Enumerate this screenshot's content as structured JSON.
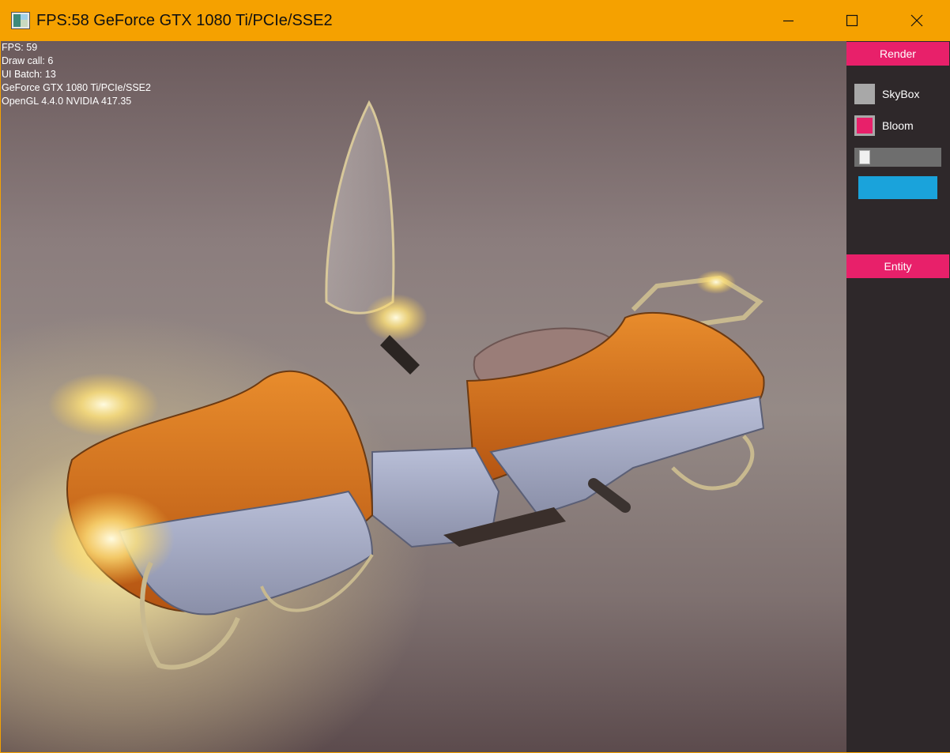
{
  "window": {
    "title": "FPS:58 GeForce GTX 1080 Ti/PCIe/SSE2",
    "accent_color": "#f5a100"
  },
  "stats": {
    "lines": [
      "FPS: 59",
      "Draw call: 6",
      "UI Batch: 13",
      "GeForce GTX 1080 Ti/PCIe/SSE2",
      "OpenGL 4.4.0 NVIDIA 417.35"
    ]
  },
  "panel": {
    "render_header": "Render",
    "entity_header": "Entity",
    "skybox": {
      "label": "SkyBox",
      "checked": false
    },
    "bloom": {
      "label": "Bloom",
      "checked": true
    },
    "slider": {
      "value": 0.03
    },
    "color_swatch": "#1aa3db",
    "header_color": "#e8206a"
  },
  "icons": {
    "app": "app-window-icon",
    "minimize": "minimize-icon",
    "maximize": "maximize-icon",
    "close": "close-icon"
  }
}
